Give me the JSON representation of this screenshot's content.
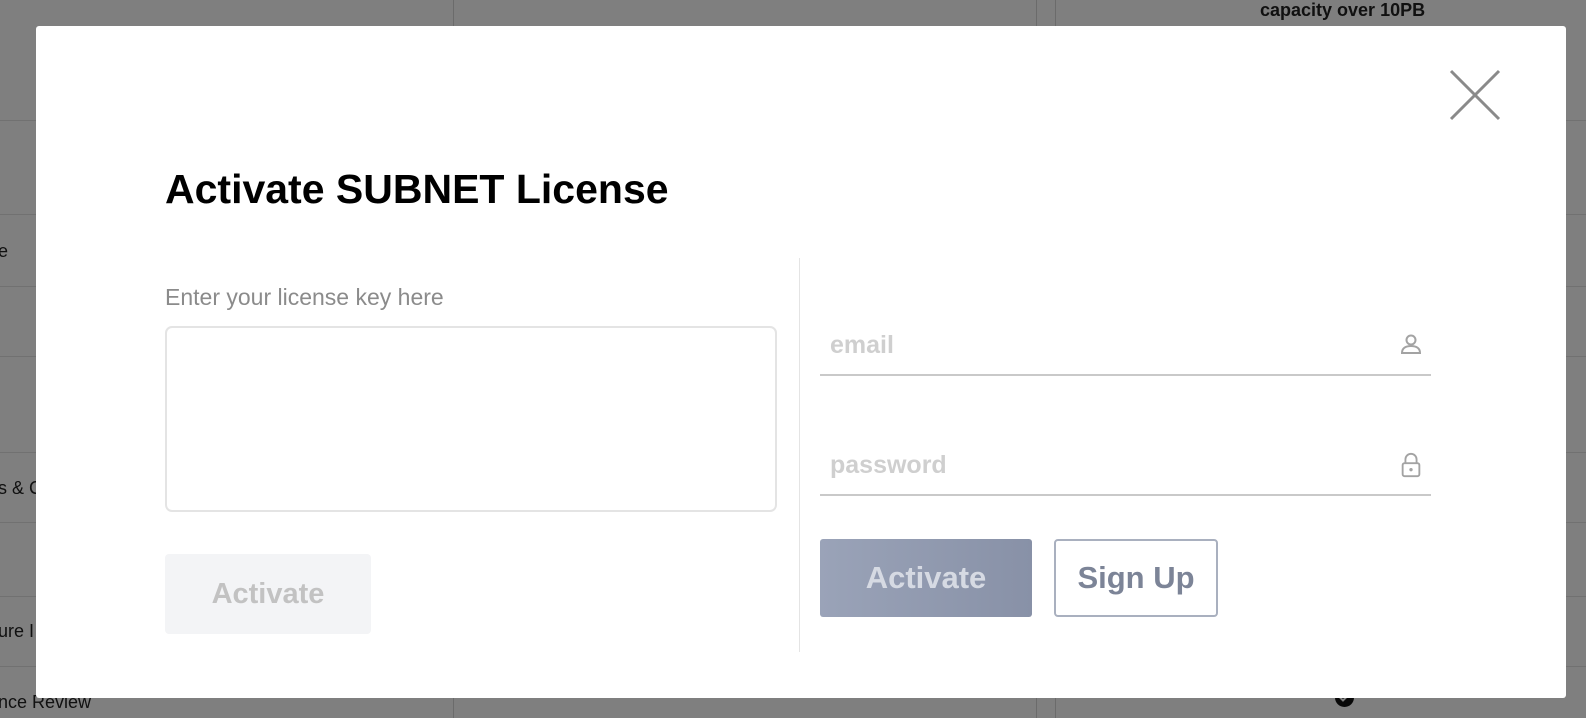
{
  "background": {
    "texts": {
      "capacity": "capacity over 10PB",
      "row_e": "e",
      "row_c": "s & C",
      "row_ure": "ure I",
      "row_review": "nce Review"
    }
  },
  "modal": {
    "title": "Activate SUBNET License",
    "license_key": {
      "label": "Enter your license key here",
      "value": ""
    },
    "left_activate_label": "Activate",
    "email": {
      "placeholder": "email",
      "value": "",
      "icon": "user-icon"
    },
    "password": {
      "placeholder": "password",
      "value": "",
      "icon": "lock-icon"
    },
    "right_activate_label": "Activate",
    "signup_label": "Sign Up",
    "close_icon": "close-icon"
  },
  "colors": {
    "overlay": "#000000",
    "primary_button_disabled": "#8f98ad",
    "secondary_button_border": "#a9b0bf",
    "disabled_button_bg": "#f3f4f6"
  }
}
